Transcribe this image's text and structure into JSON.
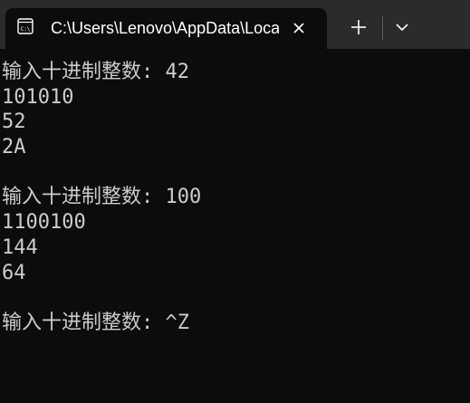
{
  "titlebar": {
    "tab_title": "C:\\Users\\Lenovo\\AppData\\Local",
    "tab_icon": "terminal-icon",
    "close_icon": "close-icon",
    "new_tab_icon": "plus-icon",
    "dropdown_icon": "chevron-down-icon"
  },
  "console": {
    "lines": [
      "输入十进制整数: 42",
      "101010",
      "52",
      "2A",
      "",
      "输入十进制整数: 100",
      "1100100",
      "144",
      "64",
      "",
      "输入十进制整数: ^Z"
    ]
  },
  "colors": {
    "background": "#0c0c0c",
    "titlebar": "#2b2b2b",
    "text": "#cccccc"
  }
}
